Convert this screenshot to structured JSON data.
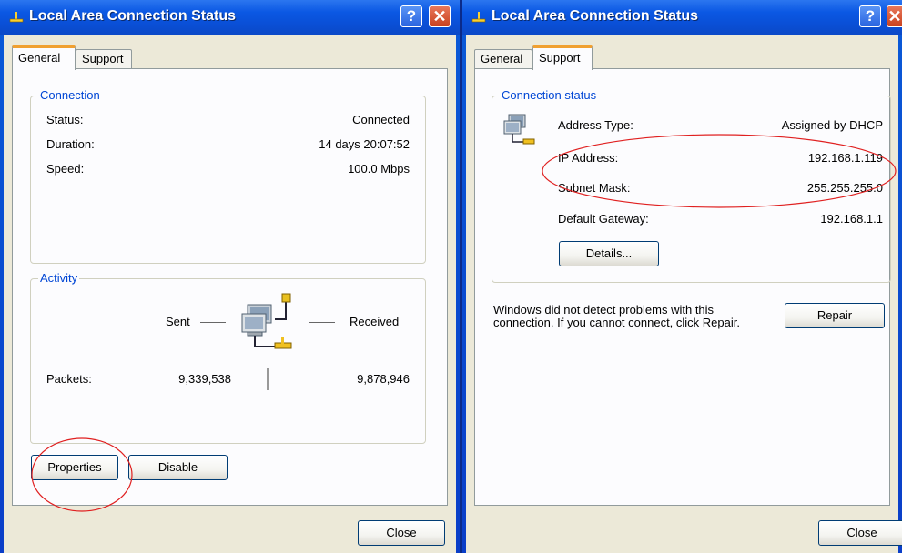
{
  "left_window": {
    "title": "Local Area Connection Status",
    "help_glyph": "?",
    "close_glyph": "✕",
    "tabs": [
      "General",
      "Support"
    ],
    "active_tab": "General",
    "connection_group_label": "Connection",
    "status_label": "Status:",
    "status_value": "Connected",
    "duration_label": "Duration:",
    "duration_value": "14 days 20:07:52",
    "speed_label": "Speed:",
    "speed_value": "100.0 Mbps",
    "activity_group_label": "Activity",
    "sent_label": "Sent",
    "received_label": "Received",
    "packets_label": "Packets:",
    "packets_sent": "9,339,538",
    "packets_received": "9,878,946",
    "properties_button": "Properties",
    "disable_button": "Disable",
    "close_button": "Close"
  },
  "right_window": {
    "title": "Local Area Connection Status",
    "help_glyph": "?",
    "close_glyph": "✕",
    "tabs": [
      "General",
      "Support"
    ],
    "active_tab": "Support",
    "connection_status_group_label": "Connection status",
    "address_type_label": "Address Type:",
    "address_type_value": "Assigned by DHCP",
    "ip_address_label": "IP Address:",
    "ip_address_value": "192.168.1.119",
    "subnet_mask_label": "Subnet Mask:",
    "subnet_mask_value": "255.255.255.0",
    "default_gateway_label": "Default Gateway:",
    "default_gateway_value": "192.168.1.1",
    "details_button": "Details...",
    "repair_message": "Windows did not detect problems with this connection. If you cannot connect, click Repair.",
    "repair_button": "Repair",
    "close_button": "Close"
  },
  "colors": {
    "title_bar": "#0b58e3",
    "dialog_bg": "#ece9d8",
    "group_label": "#0046d5",
    "annotation_ellipse": "#e02020"
  },
  "icons": [
    "network-connection-icon",
    "help-icon",
    "close-icon",
    "network-computers-icon"
  ]
}
